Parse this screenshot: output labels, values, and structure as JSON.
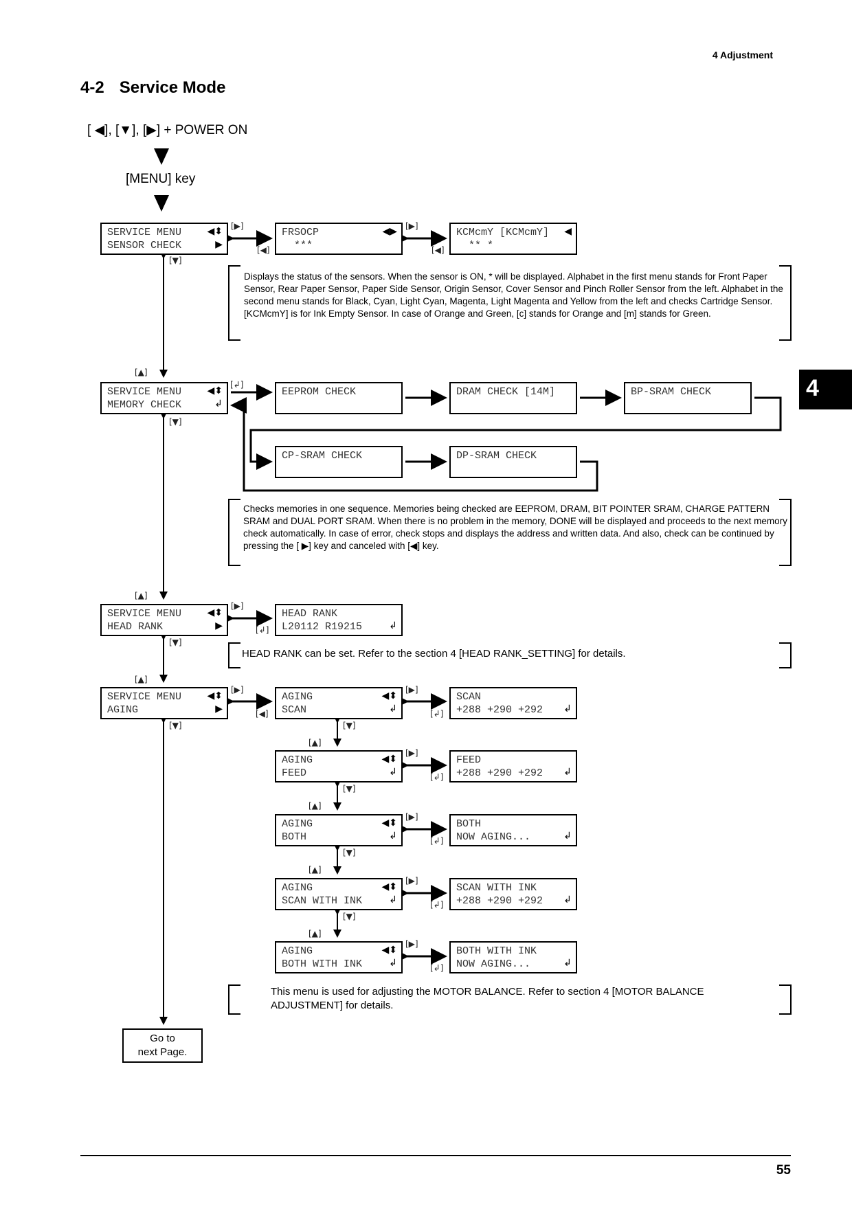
{
  "header": {
    "section": "4  Adjustment"
  },
  "title": {
    "number": "4-2",
    "text": "Service Mode"
  },
  "chapter_tab": "4",
  "startup": {
    "keys_line": "[ ◀], [▼], [▶] + POWER ON",
    "menu_key": "[MENU] key"
  },
  "key_labels": {
    "right": "[▶]",
    "left": "[◀]",
    "down": "[▼]",
    "up": "[▲]",
    "enter": "[↲]"
  },
  "icons": {
    "left_updown": "◀⬍",
    "left_right": "◀▶",
    "left": "◀",
    "right": "▶",
    "enter": "↲"
  },
  "sensor_check": {
    "menu": [
      "SERVICE MENU",
      "SENSOR CHECK"
    ],
    "screen1": [
      "FRSOCP",
      "  ***"
    ],
    "screen2": [
      "KCMcmY [KCMcmY]",
      "  ** *"
    ],
    "note": "Displays the status of the sensors.  When the sensor is ON, * will be displayed.  Alphabet in the first menu stands for Front Paper Sensor, Rear Paper Sensor, Paper Side Sensor, Origin Sensor, Cover Sensor and Pinch Roller Sensor from the left.  Alphabet in the second menu stands for Black, Cyan, Light Cyan, Magenta, Light Magenta and Yellow from the left and checks Cartridge Sensor.",
    "note2": "[KCMcmY] is for Ink Empty Sensor. In case of Orange and Green, [c] stands for Orange and [m] stands for Green."
  },
  "memory_check": {
    "menu": [
      "SERVICE MENU",
      "MEMORY CHECK"
    ],
    "steps": [
      "EEPROM CHECK",
      "DRAM CHECK [14M]",
      "BP-SRAM CHECK",
      "CP-SRAM CHECK",
      "DP-SRAM CHECK"
    ],
    "note": "Checks memories in one sequence.  Memories being checked are EEPROM, DRAM, BIT POINTER SRAM, CHARGE PATTERN SRAM and DUAL PORT SRAM.  When there is no problem in the memory, DONE will be displayed and proceeds to the next memory check automatically.  In case of error, check stops and displays the address and written data.  And also, check can be continued by pressing the [ ▶] key and canceled with [◀] key."
  },
  "head_rank": {
    "menu": [
      "SERVICE MENU",
      "HEAD RANK"
    ],
    "screen": [
      "HEAD RANK",
      "L20112 R19215"
    ],
    "note": "HEAD RANK can be set.  Refer to the section 4 [HEAD RANK_SETTING] for details."
  },
  "aging": {
    "menu": [
      "SERVICE MENU",
      "AGING"
    ],
    "items": [
      {
        "menu": [
          "AGING",
          "SCAN"
        ],
        "result": [
          "SCAN",
          "+288 +290 +292"
        ]
      },
      {
        "menu": [
          "AGING",
          "FEED"
        ],
        "result": [
          "FEED",
          "+288 +290 +292"
        ]
      },
      {
        "menu": [
          "AGING",
          "BOTH"
        ],
        "result": [
          "BOTH",
          "NOW AGING..."
        ]
      },
      {
        "menu": [
          "AGING",
          "SCAN WITH INK"
        ],
        "result": [
          "SCAN WITH INK",
          "+288 +290 +292"
        ]
      },
      {
        "menu": [
          "AGING",
          "BOTH WITH INK"
        ],
        "result": [
          "BOTH WITH INK",
          "NOW AGING..."
        ]
      }
    ],
    "note": "This menu is used for adjusting the MOTOR BALANCE.  Refer to section 4 [MOTOR BALANCE ADJUSTMENT] for details."
  },
  "go_next": [
    "Go to",
    "next Page."
  ],
  "footer": {
    "page_number": "55"
  }
}
